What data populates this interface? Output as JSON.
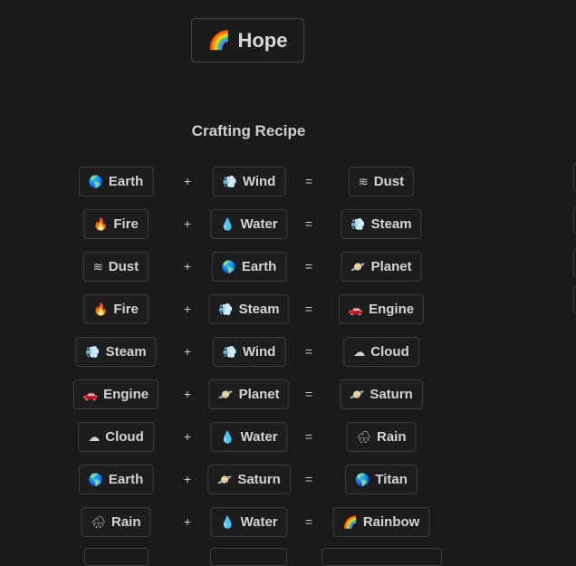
{
  "hero": {
    "emoji": "🌈",
    "label": "Hope"
  },
  "section_title": "Crafting Recipe",
  "operators": {
    "plus": "+",
    "equals": "="
  },
  "recipes": [
    {
      "a": {
        "emoji": "🌎",
        "label": "Earth"
      },
      "b": {
        "emoji": "💨",
        "label": "Wind"
      },
      "result": {
        "emoji": "≋",
        "label": "Dust"
      }
    },
    {
      "a": {
        "emoji": "🔥",
        "label": "Fire"
      },
      "b": {
        "emoji": "💧",
        "label": "Water"
      },
      "result": {
        "emoji": "💨",
        "label": "Steam"
      }
    },
    {
      "a": {
        "emoji": "≋",
        "label": "Dust"
      },
      "b": {
        "emoji": "🌎",
        "label": "Earth"
      },
      "result": {
        "emoji": "🪐",
        "label": "Planet"
      }
    },
    {
      "a": {
        "emoji": "🔥",
        "label": "Fire"
      },
      "b": {
        "emoji": "💨",
        "label": "Steam"
      },
      "result": {
        "emoji": "🚗",
        "label": "Engine"
      }
    },
    {
      "a": {
        "emoji": "💨",
        "label": "Steam"
      },
      "b": {
        "emoji": "💨",
        "label": "Wind"
      },
      "result": {
        "emoji": "☁",
        "label": "Cloud"
      }
    },
    {
      "a": {
        "emoji": "🚗",
        "label": "Engine"
      },
      "b": {
        "emoji": "🪐",
        "label": "Planet"
      },
      "result": {
        "emoji": "🪐",
        "label": "Saturn"
      }
    },
    {
      "a": {
        "emoji": "☁",
        "label": "Cloud"
      },
      "b": {
        "emoji": "💧",
        "label": "Water"
      },
      "result": {
        "emoji": "🌧",
        "label": "Rain"
      }
    },
    {
      "a": {
        "emoji": "🌎",
        "label": "Earth"
      },
      "b": {
        "emoji": "🪐",
        "label": "Saturn"
      },
      "result": {
        "emoji": "🌎",
        "label": "Titan"
      }
    },
    {
      "a": {
        "emoji": "🌧",
        "label": "Rain"
      },
      "b": {
        "emoji": "💧",
        "label": "Water"
      },
      "result": {
        "emoji": "🌈",
        "label": "Rainbow"
      }
    }
  ]
}
